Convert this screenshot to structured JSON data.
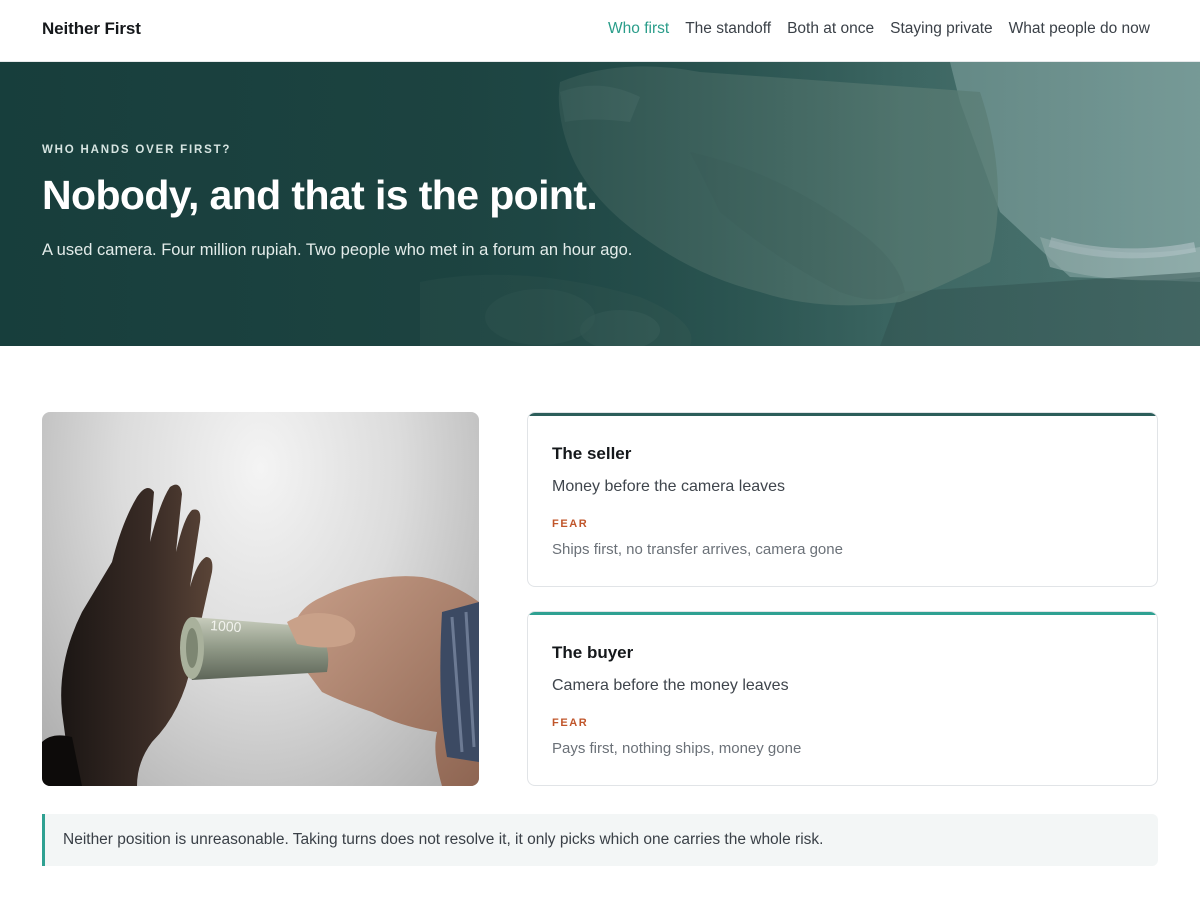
{
  "brand": "Neither First",
  "nav": {
    "items": [
      "Who first",
      "The standoff",
      "Both at once",
      "Staying private",
      "What people do now"
    ],
    "active": "Who first"
  },
  "hero": {
    "eyebrow": "WHO HANDS OVER FIRST?",
    "title": "Nobody, and that is the point.",
    "subtitle": "A used camera. Four million rupiah. Two people who met in a forum an hour ago."
  },
  "photo": {
    "banknote_text": "1000"
  },
  "cards": [
    {
      "title": "The seller",
      "text": "Money before the camera leaves",
      "fear_label": "FEAR",
      "fear_text": "Ships first, no transfer arrives, camera gone"
    },
    {
      "title": "The buyer",
      "text": "Camera before the money leaves",
      "fear_label": "FEAR",
      "fear_text": "Pays first, nothing ships, money gone"
    }
  ],
  "callout": {
    "text": "Neither position is unreasonable. Taking turns does not resolve it, it only picks which one carries the whole risk."
  },
  "colors": {
    "accent": "#2a9d8a",
    "hero_bg": "#27524f",
    "seller_bar": "#2c5e5a",
    "buyer_bar": "#2fa192",
    "fear": "#c0552a"
  }
}
